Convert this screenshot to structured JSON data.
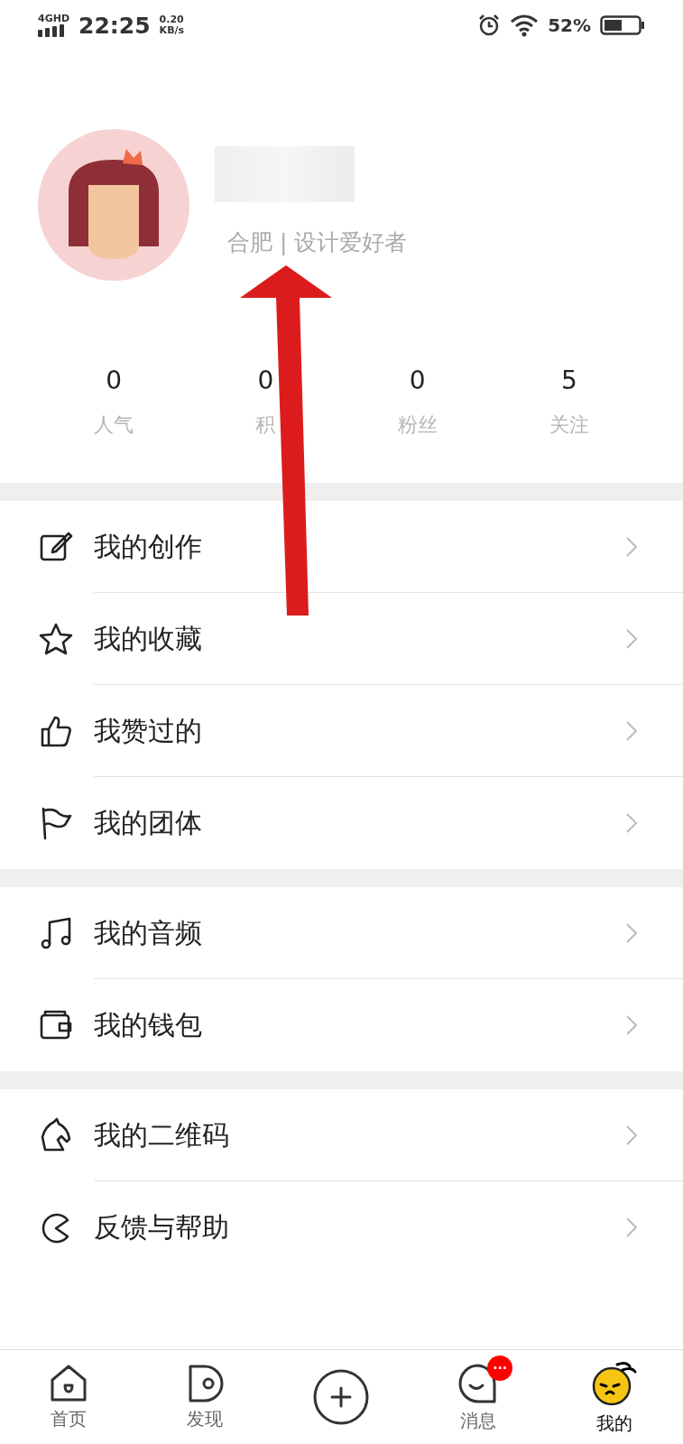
{
  "status_bar": {
    "network": "4GHD",
    "time": "22:25",
    "speed_value": "0.20",
    "speed_unit": "KB/s",
    "battery": "52%"
  },
  "profile": {
    "subtitle": "合肥 | 设计爱好者"
  },
  "stats": [
    {
      "value": "0",
      "label": "人气"
    },
    {
      "value": "0",
      "label": "积"
    },
    {
      "value": "0",
      "label": "粉丝"
    },
    {
      "value": "5",
      "label": "关注"
    }
  ],
  "menu_groups": [
    [
      {
        "label": "我的创作"
      },
      {
        "label": "我的收藏"
      },
      {
        "label": "我赞过的"
      },
      {
        "label": "我的团体"
      }
    ],
    [
      {
        "label": "我的音频"
      },
      {
        "label": "我的钱包"
      }
    ],
    [
      {
        "label": "我的二维码"
      },
      {
        "label": "反馈与帮助"
      }
    ]
  ],
  "bottom_nav": [
    {
      "label": "首页",
      "selected": false
    },
    {
      "label": "发现",
      "selected": false
    },
    {
      "label": "消息",
      "selected": false,
      "badge": "···"
    },
    {
      "label": "我的",
      "selected": true
    }
  ]
}
